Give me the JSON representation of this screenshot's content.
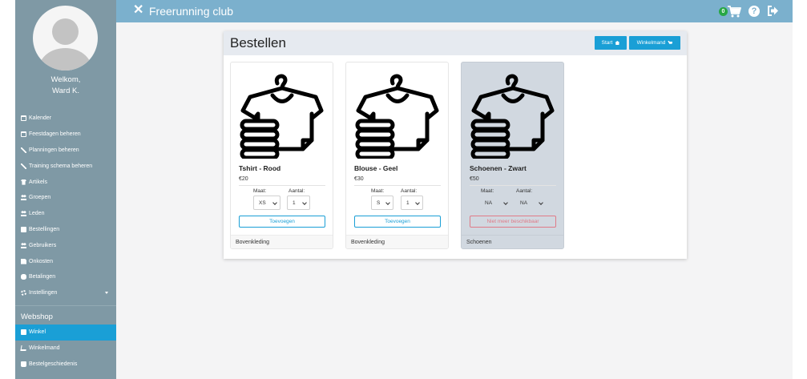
{
  "user": {
    "welcome_line1": "Welkom,",
    "welcome_line2": "Ward K."
  },
  "sidebar": {
    "items": [
      {
        "label": "Kalender",
        "icon": "calendar-icon"
      },
      {
        "label": "Feestdagen beheren",
        "icon": "calendar-icon"
      },
      {
        "label": "Planningen beheren",
        "icon": "wrench-icon"
      },
      {
        "label": "Training schema beheren",
        "icon": "wrench-icon"
      },
      {
        "label": "Artikels",
        "icon": "shirt-icon"
      },
      {
        "label": "Groepen",
        "icon": "users-icon"
      },
      {
        "label": "Leden",
        "icon": "users-icon"
      },
      {
        "label": "Bestellingen",
        "icon": "truck-icon"
      },
      {
        "label": "Gebruikers",
        "icon": "users-icon"
      },
      {
        "label": "Onkosten",
        "icon": "file-icon"
      },
      {
        "label": "Betalingen",
        "icon": "chat-icon"
      },
      {
        "label": "Instellingen",
        "icon": "gears-icon"
      }
    ],
    "webshop_heading": "Webshop",
    "webshop_items": [
      {
        "label": "Winkel",
        "icon": "store-icon",
        "active": true
      },
      {
        "label": "Winkelmand",
        "icon": "cart-icon",
        "active": false
      },
      {
        "label": "Bestelgeschiedenis",
        "icon": "bag-icon",
        "active": false
      }
    ]
  },
  "topbar": {
    "title": "Freerunning club",
    "cart_count": "0"
  },
  "panel": {
    "title": "Bestellen",
    "start_label": "Start",
    "cart_label": "Winkelmand"
  },
  "products": [
    {
      "name": "Tshirt - Rood",
      "price": "€20",
      "size_label": "Maat:",
      "qty_label": "Aantal:",
      "size": "XS",
      "qty": "1",
      "button": "Toevoegen",
      "category": "Bovenkleding",
      "available": true
    },
    {
      "name": "Blouse - Geel",
      "price": "€30",
      "size_label": "Maat:",
      "qty_label": "Aantal:",
      "size": "S",
      "qty": "1",
      "button": "Toevoegen",
      "category": "Bovenkleding",
      "available": true
    },
    {
      "name": "Schoenen - Zwart",
      "price": "€50",
      "size_label": "Maat:",
      "qty_label": "Aantal:",
      "size": "NA",
      "qty": "NA",
      "button": "Niet meer beschikbaar",
      "category": "Schoenen",
      "available": false
    }
  ],
  "colors": {
    "sidebar": "#7f99a5",
    "topbar": "#7bb0cd",
    "accent": "#1a9fd6",
    "unavailable_card": "#d1d8e0",
    "unavailable_button": "#e07b88",
    "badge": "#28a745"
  }
}
